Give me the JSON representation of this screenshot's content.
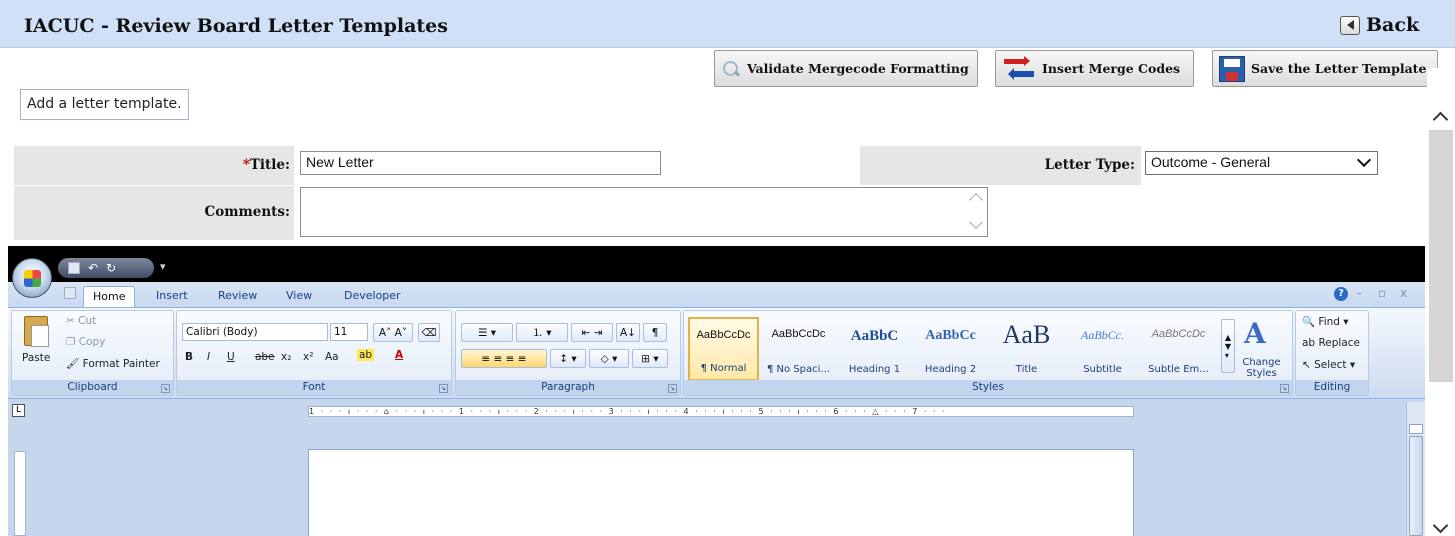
{
  "header": {
    "title": "IACUC - Review Board Letter Templates",
    "back_label": "Back"
  },
  "toolbar": {
    "validate_label": "Validate Mergecode Formatting",
    "merge_label": "Insert Merge Codes",
    "save_label": "Save the Letter Template"
  },
  "note": "Add a letter template.",
  "form": {
    "title_required_mark": "*",
    "title_label": "Title:",
    "title_value": "New Letter",
    "letter_type_label": "Letter Type:",
    "letter_type_value": "Outcome - General",
    "comments_label": "Comments:",
    "comments_value": ""
  },
  "word": {
    "qat_dropdown": "▾",
    "tabs": [
      "Home",
      "Insert",
      "Review",
      "View",
      "Developer"
    ],
    "active_tab": "Home",
    "window_controls": {
      "help": "?",
      "minimize": "–",
      "restore": "▫",
      "close": "x"
    },
    "clipboard": {
      "paste": "Paste",
      "cut": "Cut",
      "copy": "Copy",
      "format_painter": "Format Painter",
      "group": "Clipboard"
    },
    "font": {
      "name": "Calibri (Body)",
      "size": "11",
      "group": "Font",
      "grow": "A˄",
      "shrink": "A˅",
      "bold": "B",
      "italic": "I",
      "underline": "U",
      "strike": "abe",
      "subscript": "x₂",
      "superscript": "x²",
      "change_case": "Aa",
      "highlight": "ab",
      "color": "A"
    },
    "paragraph": {
      "group": "Paragraph",
      "sort": "A↓",
      "pilcrow": "¶"
    },
    "styles": {
      "group": "Styles",
      "items": [
        {
          "preview": "AaBbCcDc",
          "name": "¶ Normal"
        },
        {
          "preview": "AaBbCcDc",
          "name": "¶ No Spaci..."
        },
        {
          "preview": "AaBbC",
          "name": "Heading 1"
        },
        {
          "preview": "AaBbCc",
          "name": "Heading 2"
        },
        {
          "preview": "AaB",
          "name": "Title"
        },
        {
          "preview": "AaBbCc.",
          "name": "Subtitle"
        },
        {
          "preview": "AaBbCcDc",
          "name": "Subtle Em..."
        }
      ],
      "change_styles": "Change Styles"
    },
    "editing": {
      "group": "Editing",
      "find": "Find",
      "replace": "Replace",
      "select": "Select"
    },
    "ruler_text": "1 · · · ı · · · ⌂ · · · ı · · · 1 · · · ı · · · 2 · · · ı · · · 3 · · · ı · · · 4 · · · ı · · · 5 · · · ı · · · 6 · · · △ · · · 7 · · ·",
    "tab_selector": "L"
  }
}
